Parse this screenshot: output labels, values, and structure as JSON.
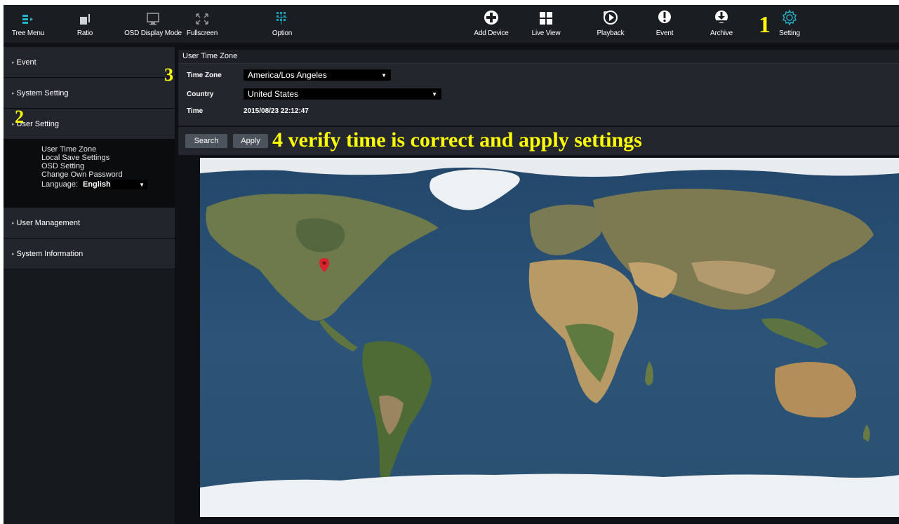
{
  "toolbar": {
    "left": [
      {
        "label": "Tree Menu",
        "icon": "tree-menu-icon"
      },
      {
        "label": "Ratio",
        "icon": "ratio-icon"
      },
      {
        "label": "OSD Display Mode",
        "icon": "monitor-icon"
      },
      {
        "label": "Fullscreen",
        "icon": "fullscreen-icon"
      },
      {
        "label": "Option",
        "icon": "grid-option-icon"
      }
    ],
    "right": [
      {
        "label": "Add Device",
        "icon": "plus-circle-icon"
      },
      {
        "label": "Live View",
        "icon": "four-squares-icon"
      },
      {
        "label": "Playback",
        "icon": "play-circle-icon"
      },
      {
        "label": "Event",
        "icon": "alert-icon"
      },
      {
        "label": "Archive",
        "icon": "archive-download-icon"
      },
      {
        "label": "Setting",
        "icon": "gear-icon"
      }
    ]
  },
  "sidebar": {
    "sections": [
      {
        "label": "Event"
      },
      {
        "label": "System Setting"
      },
      {
        "label": "User Setting"
      },
      {
        "label": "User Management"
      },
      {
        "label": "System Information"
      }
    ],
    "user_setting_items": [
      "User Time Zone",
      "Local Save Settings",
      "OSD Setting",
      "Change Own Password"
    ],
    "language_label": "Language:",
    "language_value": "English"
  },
  "timezone_panel": {
    "title": "User Time Zone",
    "time_zone_label": "Time Zone",
    "time_zone_value": "America/Los Angeles",
    "country_label": "Country",
    "country_value": "United States",
    "time_label": "Time",
    "time_value": "2015/08/23 22:12:47"
  },
  "buttons": {
    "search": "Search",
    "apply": "Apply"
  },
  "annotations": {
    "step1": "1",
    "step2": "2",
    "step3": "3",
    "step4": "4 verify time is correct and apply settings"
  },
  "colors": {
    "accent": "#26b3c9",
    "annotation": "#ffff00",
    "pin": "#d9232e"
  }
}
